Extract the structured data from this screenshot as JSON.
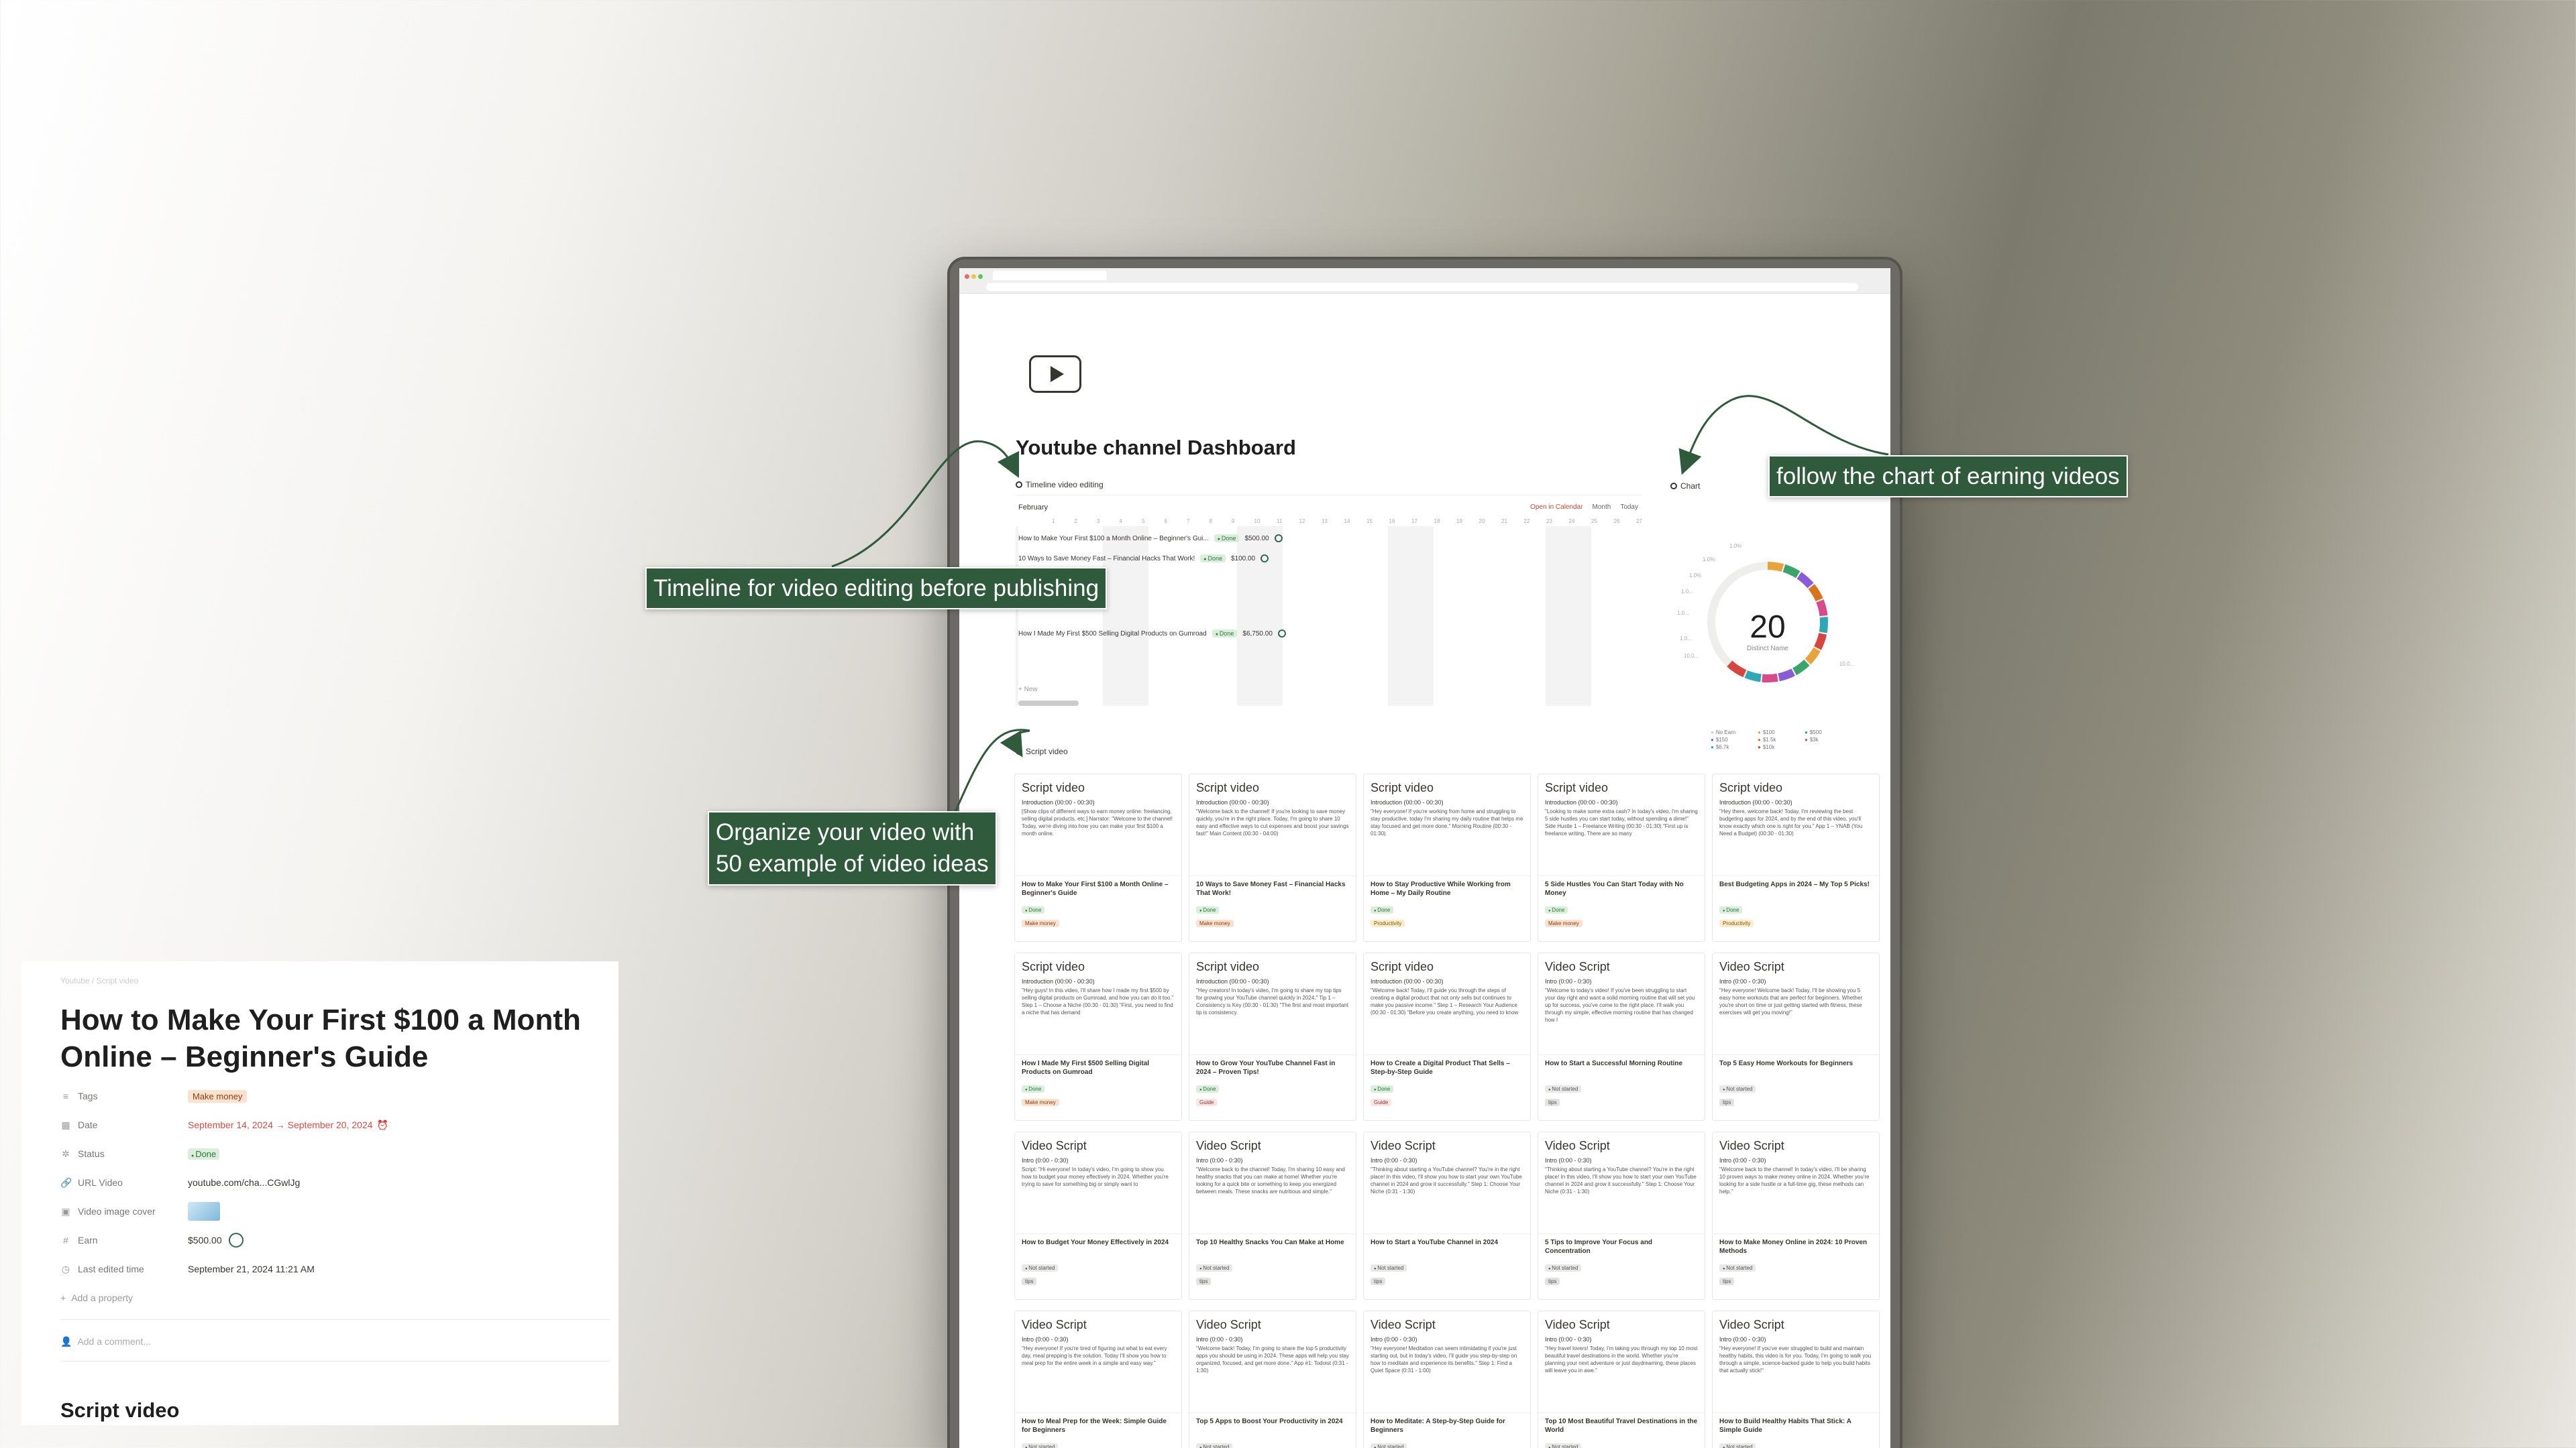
{
  "dashboard": {
    "title": "Youtube channel Dashboard",
    "timeline_section": "Timeline video editing",
    "chart_section": "Chart",
    "script_section": "Script video",
    "timeline": {
      "month": "February",
      "open_calendar": "Open in Calendar",
      "view": "Month",
      "today": "Today",
      "days": [
        "1",
        "2",
        "3",
        "4",
        "5",
        "6",
        "7",
        "8",
        "9",
        "10",
        "11",
        "12",
        "13",
        "14",
        "15",
        "16",
        "17",
        "18",
        "19",
        "20",
        "21",
        "22",
        "23",
        "24",
        "25",
        "26",
        "27"
      ],
      "rows": [
        {
          "name": "How to Make Your First $100 a Month Online – Beginner's Gui...",
          "status": "Done",
          "earn": "$500.00"
        },
        {
          "name": "10 Ways to Save Money Fast – Financial Hacks That Work!",
          "status": "Done",
          "earn": "$100.00"
        },
        {
          "name": "How I Made My First $500 Selling Digital Products on Gumroad",
          "status": "Done",
          "earn": "$6,750.00"
        }
      ],
      "new_label": "New"
    },
    "chart": {
      "value": "20",
      "label": "Distinct Name",
      "ticks": [
        "1.0%",
        "1.0%",
        "1.0%",
        "1.0...",
        "1.0...",
        "1.0...",
        "10.0...",
        "10.0..."
      ],
      "legend": [
        "No Earn",
        "$100",
        "$500",
        "$150",
        "$1.5k",
        "$3k",
        "$6.7k",
        "$10k"
      ]
    },
    "cards": [
      {
        "h": "Script video",
        "intro": "Introduction (00:00 - 00:30)",
        "body": "[Show clips of different ways to earn money online: freelancing, selling digital products, etc.] Narrator: \"Welcome to the channel! Today, we're diving into how you can make your first $100 a month online.",
        "name": "How to Make Your First $100 a Month Online – Beginner's Guide",
        "status": "Done",
        "tag": "Make money"
      },
      {
        "h": "Script video",
        "intro": "Introduction (00:00 - 00:30)",
        "body": "\"Welcome back to the channel! If you're looking to save money quickly, you're in the right place. Today, I'm going to share 10 easy and effective ways to cut expenses and boost your savings fast!\" Main Content (00:30 - 04:00)",
        "name": "10 Ways to Save Money Fast – Financial Hacks That Work!",
        "status": "Done",
        "tag": "Make money"
      },
      {
        "h": "Script video",
        "intro": "Introduction (00:00 - 00:30)",
        "body": "\"Hey everyone! If you're working from home and struggling to stay productive, today I'm sharing my daily routine that helps me stay focused and get more done.\" Morning Routine (00:30 - 01:30)",
        "name": "How to Stay Productive While Working from Home – My Daily Routine",
        "status": "Done",
        "tag": "Productivity"
      },
      {
        "h": "Script video",
        "intro": "Introduction (00:00 - 00:30)",
        "body": "\"Looking to make some extra cash? In today's video, I'm sharing 5 side hustles you can start today, without spending a dime!\" Side Hustle 1 – Freelance Writing (00:30 - 01:30) \"First up is freelance writing. There are so many",
        "name": "5 Side Hustles You Can Start Today with No Money",
        "status": "Done",
        "tag": "Make money"
      },
      {
        "h": "Script video",
        "intro": "Introduction (00:00 - 00:30)",
        "body": "\"Hey there, welcome back! Today, I'm reviewing the best budgeting apps for 2024, and by the end of this video, you'll know exactly which one is right for you.\" App 1 – YNAB (You Need a Budget) (00:30 - 01:30)",
        "name": "Best Budgeting Apps in 2024 – My Top 5 Picks!",
        "status": "Done",
        "tag": "Productivity"
      },
      {
        "h": "Script video",
        "intro": "Introduction (00:00 - 00:30)",
        "body": "\"Hey guys! In this video, I'll share how I made my first $500 by selling digital products on Gumroad, and how you can do it too.\" Step 1 – Choose a Niche (00:30 - 01:30) \"First, you need to find a niche that has demand",
        "name": "How I Made My First $500 Selling Digital Products on Gumroad",
        "status": "Done",
        "tag": "Make money"
      },
      {
        "h": "Script video",
        "intro": "Introduction (00:00 - 00:30)",
        "body": "\"Hey creators! In today's video, I'm going to share my top tips for growing your YouTube channel quickly in 2024.\" Tip 1 – Consistency is Key (00:30 - 01:30) \"The first and most important tip is consistency.",
        "name": "How to Grow Your YouTube Channel Fast in 2024 – Proven Tips!",
        "status": "Done",
        "tag": "Guide"
      },
      {
        "h": "Script video",
        "intro": "Introduction (00:00 - 00:30)",
        "body": "\"Welcome back! Today, I'll guide you through the steps of creating a digital product that not only sells but continues to make you passive income.\" Step 1 – Research Your Audience (00:30 - 01:30) \"Before you create anything, you need to know",
        "name": "How to Create a Digital Product That Sells – Step-by-Step Guide",
        "status": "Done",
        "tag": "Guide"
      },
      {
        "h": "Video Script",
        "intro": "Intro (0:00 - 0:30)",
        "body": "\"Welcome to today's video! If you've been struggling to start your day right and want a solid morning routine that will set you up for success, you've come to the right place. I'll walk you through my simple, effective morning routine that has changed how I",
        "name": "How to Start a Successful Morning Routine",
        "status": "Not started",
        "tag": "tips"
      },
      {
        "h": "Video Script",
        "intro": "Intro (0:00 - 0:30)",
        "body": "\"Hey everyone! Welcome back! Today, I'll be showing you 5 easy home workouts that are perfect for beginners. Whether you're short on time or just getting started with fitness, these exercises will get you moving!\"",
        "name": "Top 5 Easy Home Workouts for Beginners",
        "status": "Not started",
        "tag": "tips"
      },
      {
        "h": "Video Script",
        "intro": "Intro (0:00 - 0:30)",
        "body": "Script: \"Hi everyone! In today's video, I'm going to show you how to budget your money effectively in 2024. Whether you're trying to save for something big or simply want to",
        "name": "How to Budget Your Money Effectively in 2024",
        "status": "Not started",
        "tag": "tips"
      },
      {
        "h": "Video Script",
        "intro": "Intro (0:00 - 0:30)",
        "body": "\"Welcome back to the channel! Today, I'm sharing 10 easy and healthy snacks that you can make at home! Whether you're looking for a quick bite or something to keep you energized between meals. These snacks are nutritious and simple.\"",
        "name": "Top 10 Healthy Snacks You Can Make at Home",
        "status": "Not started",
        "tag": "tips"
      },
      {
        "h": "Video Script",
        "intro": "Intro (0:00 - 0:30)",
        "body": "\"Thinking about starting a YouTube channel? You're in the right place! In this video, I'll show you how to start your own YouTube channel in 2024 and grow it successfully.\" Step 1: Choose Your Niche (0:31 - 1:30)",
        "name": "How to Start a YouTube Channel in 2024",
        "status": "Not started",
        "tag": "tips"
      },
      {
        "h": "Video Script",
        "intro": "Intro (0:00 - 0:30)",
        "body": "\"Thinking about starting a YouTube channel? You're in the right place! In this video, I'll show you how to start your own YouTube channel in 2024 and grow it successfully.\" Step 1: Choose Your Niche (0:31 - 1:30)",
        "name": "5 Tips to Improve Your Focus and Concentration",
        "status": "Not started",
        "tag": "tips"
      },
      {
        "h": "Video Script",
        "intro": "Intro (0:00 - 0:30)",
        "body": "\"Welcome back to the channel! In today's video, I'll be sharing 10 proven ways to make money online in 2024. Whether you're looking for a side hustle or a full-time gig, these methods can help.\"",
        "name": "How to Make Money Online in 2024: 10 Proven Methods",
        "status": "Not started",
        "tag": "tips"
      },
      {
        "h": "Video Script",
        "intro": "Intro (0:00 - 0:30)",
        "body": "\"Hey everyone! If you're tired of figuring out what to eat every day, meal prepping is the solution. Today I'll show you how to meal prep for the entire week in a simple and easy way.\"",
        "name": "How to Meal Prep for the Week: Simple Guide for Beginners",
        "status": "Not started",
        "tag": "tips"
      },
      {
        "h": "Video Script",
        "intro": "Intro (0:00 - 0:30)",
        "body": "\"Welcome back! Today, I'm going to share the top 5 productivity apps you should be using in 2024. These apps will help you stay organized, focused, and get more done.\" App #1: Todoist (0:31 - 1:30)",
        "name": "Top 5 Apps to Boost Your Productivity in 2024",
        "status": "Not started",
        "tag": "tips"
      },
      {
        "h": "Video Script",
        "intro": "Intro (0:00 - 0:30)",
        "body": "\"Hey everyone! Meditation can seem intimidating if you're just starting out, but in today's video, I'll guide you step-by-step on how to meditate and experience its benefits.\" Step 1: Find a Quiet Space (0:31 - 1:00)",
        "name": "How to Meditate: A Step-by-Step Guide for Beginners",
        "status": "Not started",
        "tag": "tips"
      },
      {
        "h": "Video Script",
        "intro": "Intro (0:00 - 0:30)",
        "body": "\"Hey travel lovers! Today, I'm taking you through my top 10 most beautiful travel destinations in the world. Whether you're planning your next adventure or just daydreaming, these places will leave you in awe.\"",
        "name": "Top 10 Most Beautiful Travel Destinations in the World",
        "status": "Not started",
        "tag": "tips"
      },
      {
        "h": "Video Script",
        "intro": "Intro (0:00 - 0:30)",
        "body": "\"Hey everyone! If you've ever struggled to build and maintain healthy habits, this video is for you. Today, I'm going to walk you through a simple, science-backed guide to help you build habits that actually stick!\"",
        "name": "How to Build Healthy Habits That Stick: A Simple Guide",
        "status": "Not started",
        "tag": "tips"
      }
    ]
  },
  "callouts": {
    "timeline": "Timeline for video editing before publishing",
    "chart": "follow the chart of earning videos",
    "organize_1": "Organize your video with",
    "organize_2": "50 example of video ideas"
  },
  "detail": {
    "breadcrumb": "Youtube  /  Script video",
    "title": "How to Make Your First $100 a Month Online – Beginner's Guide",
    "tags_label": "Tags",
    "tags_value": "Make money",
    "date_label": "Date",
    "date_value": "September 14, 2024 → September 20, 2024",
    "status_label": "Status",
    "status_value": "Done",
    "url_label": "URL Video",
    "url_value": "youtube.com/cha...CGwlJg",
    "cover_label": "Video image cover",
    "earn_label": "Earn",
    "earn_value": "$500.00",
    "edited_label": "Last edited time",
    "edited_value": "September 21, 2024 11:21 AM",
    "add_property": "Add a property",
    "add_comment": "Add a comment...",
    "script_heading": "Script video"
  },
  "colors": {
    "callout_bg": "#2f5a3c",
    "done": "#2b7a3b",
    "make_money_tag": "#fae2cf"
  }
}
